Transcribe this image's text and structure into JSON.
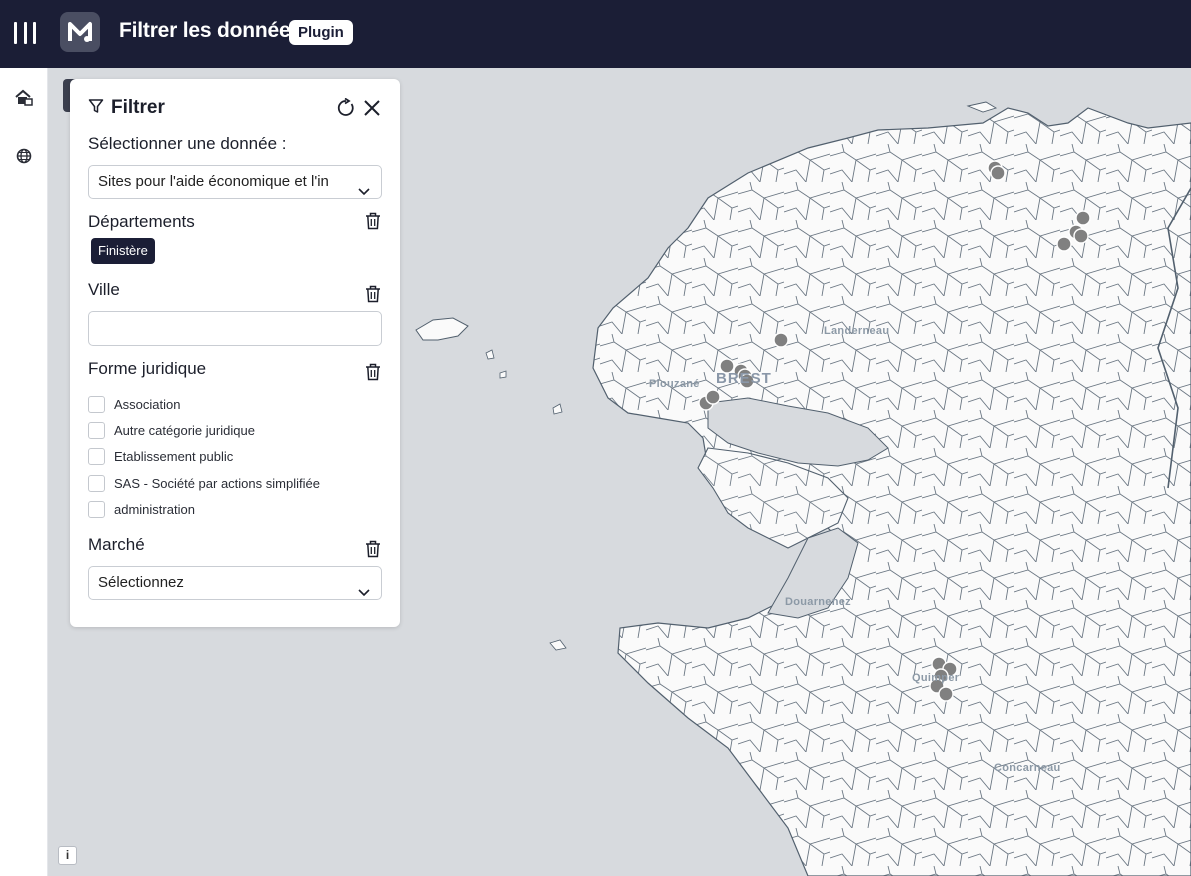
{
  "header": {
    "title": "Filtrer les données",
    "badge": "Plugin"
  },
  "panel": {
    "title": "Filtrer",
    "select_label": "Sélectionner une donnée :",
    "dataset_value": "Sites pour l'aide économique et l'in",
    "sections": {
      "departements": {
        "title": "Départements",
        "chip": "Finistère"
      },
      "ville": {
        "title": "Ville",
        "value": ""
      },
      "forme_juridique": {
        "title": "Forme juridique",
        "options": [
          "Association",
          "Autre catégorie juridique",
          "Etablissement public",
          "SAS - Société par actions simplifiée",
          "administration"
        ]
      },
      "marche": {
        "title": "Marché",
        "value": "Sélectionnez"
      }
    }
  },
  "map": {
    "labels": {
      "brest": "BREST",
      "plouzane": "Plouzané",
      "landerneau": "Landerneau",
      "douarnenez": "Douarnenez",
      "quimper": "Quimper",
      "concarneau": "Concarneau"
    },
    "info": "i"
  },
  "colors": {
    "topbar": "#1b1e36",
    "marker": "#808080",
    "sea": "#d7dade",
    "land": "#fafafa",
    "boundary": "#52606e"
  },
  "icons": {
    "menu": "menu-icon",
    "home": "home-icon",
    "globe": "globe-icon",
    "filter": "filter-icon",
    "reset": "reset-icon",
    "close": "close-icon",
    "trash": "trash-icon",
    "chevron": "chevron-down-icon"
  }
}
